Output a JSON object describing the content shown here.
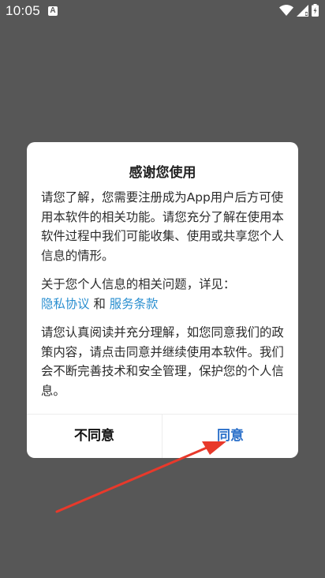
{
  "status_bar": {
    "time": "10:05",
    "notification_letter": "A"
  },
  "dialog": {
    "title": "感谢您使用",
    "paragraph_1": "请您了解，您需要注册成为App用户后方可使用本软件的相关功能。请您充分了解在使用本软件过程中我们可能收集、使用或共享您个人信息的情形。",
    "paragraph_2_prefix": "关于您个人信息的相关问题，详见：",
    "privacy_link": "隐私协议",
    "link_separator": "和",
    "terms_link": "服务条款",
    "paragraph_3": "请您认真阅读并充分理解，如您同意我们的政策内容，请点击同意并继续使用本软件。我们会不断完善技术和安全管理，保护您的个人信息。",
    "disagree_button": "不同意",
    "agree_button": "同意"
  },
  "colors": {
    "overlay": "#575757",
    "link": "#2a8fd0",
    "agree": "#2a6fc9",
    "annotation_arrow": "#e8392b"
  }
}
